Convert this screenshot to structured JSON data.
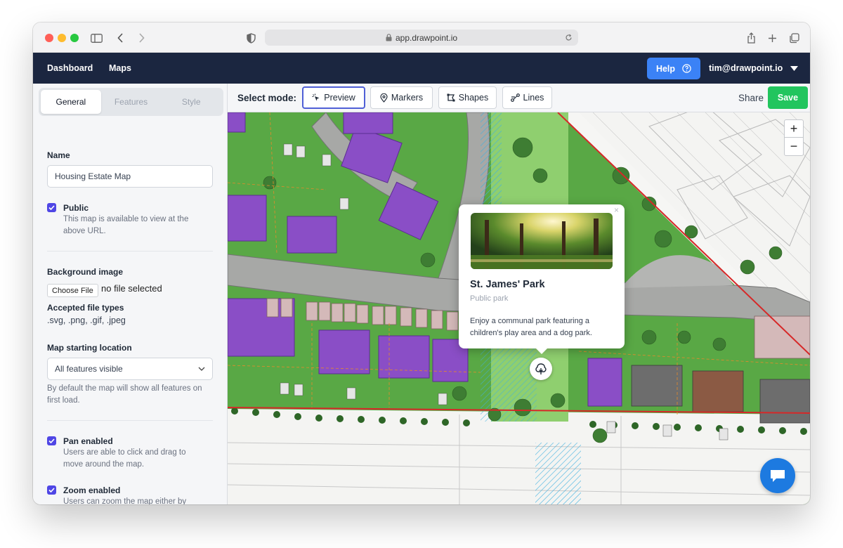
{
  "browser": {
    "url": "app.drawpoint.io"
  },
  "nav": {
    "dashboard": "Dashboard",
    "maps": "Maps",
    "help": "Help",
    "user": "tim@drawpoint.io"
  },
  "sidebar": {
    "tabs": [
      "General",
      "Features",
      "Style"
    ],
    "name_label": "Name",
    "name_value": "Housing Estate Map",
    "public_label": "Public",
    "public_desc": "This map is available to view at the above URL.",
    "bg_label": "Background image",
    "choose_file": "Choose File",
    "no_file": "no file selected",
    "types_label": "Accepted file types",
    "types_value": ".svg, .png, .gif, .jpeg",
    "start_label": "Map starting location",
    "start_value": "All features visible",
    "start_help": "By default the map will show all features on first load.",
    "pan_label": "Pan enabled",
    "pan_desc": "Users are able to click and drag to move around the map.",
    "zoom_label": "Zoom enabled",
    "zoom_desc": "Users can zoom the map either by using the control panel, scrolling, or double-clicking."
  },
  "toolbar": {
    "select_mode": "Select mode:",
    "modes": [
      "Preview",
      "Markers",
      "Shapes",
      "Lines"
    ],
    "share": "Share",
    "save": "Save"
  },
  "map": {
    "zoom_in": "+",
    "zoom_out": "−",
    "popup": {
      "title": "St. James' Park",
      "subtitle": "Public park",
      "description": "Enjoy a communal park featuring a children's play area and a dog park.",
      "close": "×"
    }
  },
  "colors": {
    "nav_bg": "#1b2640",
    "accent": "#3b82f6",
    "save": "#22c55e",
    "checkbox": "#4f46e5",
    "chat": "#1d7ae0"
  }
}
